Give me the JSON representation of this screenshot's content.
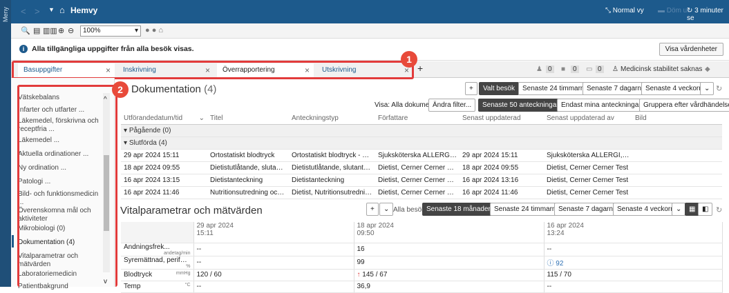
{
  "sidebar": {
    "label": "Meny"
  },
  "titlebar": {
    "title": "Hemvy",
    "back": "<",
    "fwd": ">",
    "normal_view": "Normal vy",
    "timer": "3 minuter se",
    "dimmed": "Döm ut"
  },
  "toolbar": {
    "zoom": "100%"
  },
  "info": {
    "text": "Alla tillgängliga uppgifter från alla besök visas.",
    "show_care": "Visa vårdenheter"
  },
  "tabs": [
    "Basuppgifter",
    "Inskrivning",
    "Överrapportering",
    "Utskrivning"
  ],
  "tabs_right": {
    "count1": "0",
    "count2": "0",
    "count3": "0",
    "stability": "Medicinsk stabilitet saknas"
  },
  "left_menu": [
    "Vätskebalans",
    "Infarter och utfarter ...",
    "Läkemedel, förskrivna och receptfria ...",
    "Läkemedel ...",
    "Aktuella ordinationer ...",
    "Ny ordination ...",
    "Patologi ...",
    "Bild- och funktionsmedicin ...",
    "Överenskomna mål och aktiviteter",
    "Mikrobiologi (0)",
    "Dokumentation (4)",
    "Vitalparametrar och mätvärden",
    "Laboratoriemedicin",
    "Patientbakgrund"
  ],
  "annotations": {
    "one": "1",
    "two": "2"
  },
  "documentation": {
    "title": "Dokumentation",
    "count": "(4)",
    "visits": [
      "Valt besök",
      "Senaste 24 timmarna",
      "Senaste 7 dagarna",
      "Senaste 4 veckorna"
    ],
    "show_label": "Visa: Alla dokument",
    "change_filter": "Ändra filter...",
    "filters": [
      "Senaste 50 anteckningarna",
      "Endast mina anteckningar",
      "Gruppera efter vårdhändelse"
    ],
    "columns": [
      "Utförandedatum/tid",
      "Titel",
      "Anteckningstyp",
      "Författare",
      "Senast uppdaterad",
      "Senast uppdaterad av",
      "Bild"
    ],
    "groups": [
      "Pågående (0)",
      "Slutförda (4)"
    ],
    "rows": [
      [
        "29 apr 2024 15:11",
        "Ortostatiskt blodtryck",
        "Ortostatiskt blodtryck - Text",
        "Sjuksköterska ALLERGI, Oracl...",
        "29 apr 2024 15:11",
        "Sjuksköterska ALLERGI, Oracl..."
      ],
      [
        "18 apr 2024 09:55",
        "Dietistutlåtande, slutanteckning",
        "Dietistutlåtande, slutanteckni...",
        "Dietist, Cerner Cerner Test",
        "18 apr 2024 09:55",
        "Dietist, Cerner Cerner Test"
      ],
      [
        "16 apr 2024 13:15",
        "Dietistanteckning",
        "Dietistanteckning",
        "Dietist, Cerner Cerner Test",
        "16 apr 2024 13:16",
        "Dietist, Cerner Cerner Test"
      ],
      [
        "16 apr 2024 11:46",
        "Nutritionsutredning och åtgär...",
        "Dietist, Nutritionsutredning -...",
        "Dietist, Cerner Cerner Test",
        "16 apr 2024 11:46",
        "Dietist, Cerner Cerner Test"
      ]
    ]
  },
  "vitals": {
    "title": "Vitalparametrar och mätvärden",
    "all_visits": "Alla besök",
    "ranges": [
      "Senaste 18 månaderna",
      "Senaste 24 timmarna",
      "Senaste 7 dagarna",
      "Senaste 4 veckorna"
    ],
    "dates": [
      [
        "29 apr 2024",
        "15:11"
      ],
      [
        "18 apr 2024",
        "09:50"
      ],
      [
        "16 apr 2024",
        "13:24"
      ]
    ],
    "rows": [
      {
        "name": "Andningsfrek...",
        "unit": "andetag/min",
        "v": [
          "--",
          "16",
          "--"
        ]
      },
      {
        "name": "Syremättnad, perifer (...",
        "unit": "%",
        "v": [
          "--",
          "99",
          "92"
        ]
      },
      {
        "name": "Blodtryck",
        "unit": "mmHg",
        "v": [
          "120 / 60",
          "145 / 67",
          "115 / 70"
        ]
      },
      {
        "name": "Temp",
        "unit": "°C",
        "v": [
          "--",
          "36,9",
          "--"
        ]
      }
    ]
  }
}
